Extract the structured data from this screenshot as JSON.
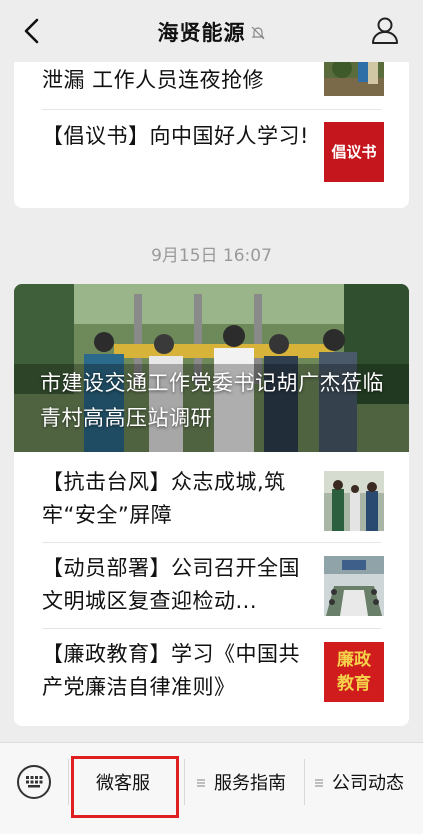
{
  "header": {
    "title": "海贤能源",
    "back_icon": "chevron-left-icon",
    "mute_icon": "bell-muted-icon",
    "profile_icon": "user-profile-icon"
  },
  "feed_top": {
    "items": [
      {
        "text": "泄漏 工作人员连夜抢修",
        "thumb_icon": "repair-photo"
      },
      {
        "text": "【倡议书】向中国好人学习!",
        "thumb_label": "倡议书"
      }
    ]
  },
  "timestamp": "9月15日 16:07",
  "feed_main": {
    "hero_title": "市建设交通工作党委书记胡广杰莅临青村高高压站调研",
    "items": [
      {
        "text": "【抗击台风】众志成城,筑牢“安全”屏障",
        "thumb_icon": "people-standing-photo"
      },
      {
        "text": "【动员部署】公司召开全国文明城区复查迎检动...",
        "thumb_icon": "meeting-room-photo"
      },
      {
        "text": "【廉政教育】学习《中国共产党廉洁自律准则》",
        "thumb_label_line1": "廉政",
        "thumb_label_line2": "教育"
      }
    ]
  },
  "menu": {
    "keyboard_icon": "keyboard-icon",
    "items": [
      {
        "label": "微客服"
      },
      {
        "label": "服务指南"
      },
      {
        "label": "公司动态"
      }
    ]
  },
  "colors": {
    "background": "#ededed",
    "card": "#ffffff",
    "highlight": "#e02020",
    "badge_red": "#c4161c"
  }
}
